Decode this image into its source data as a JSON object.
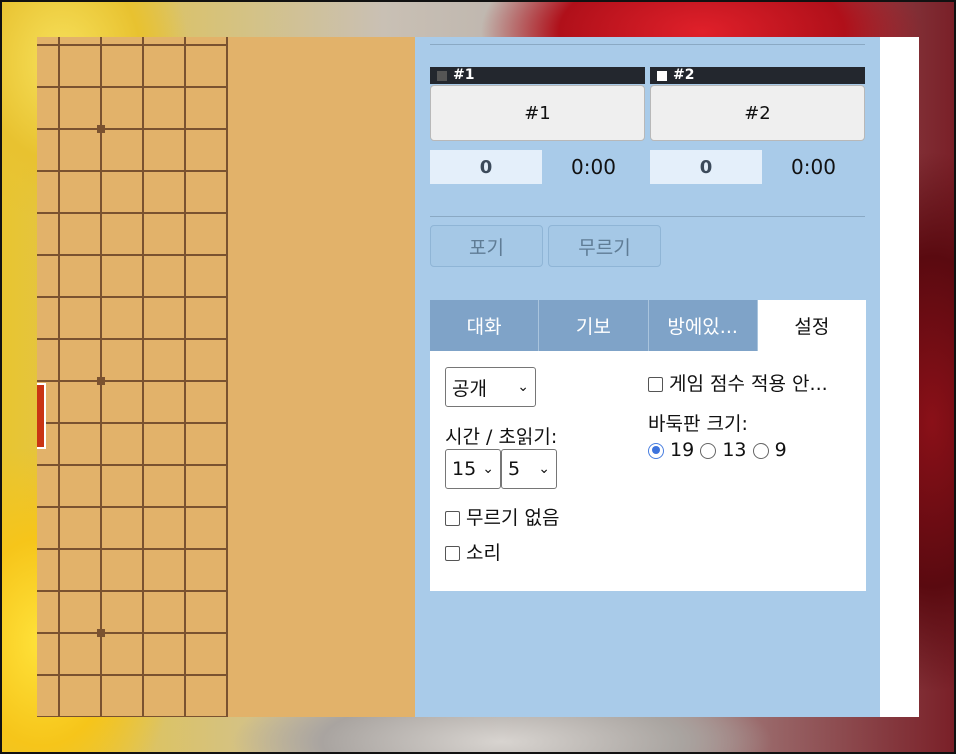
{
  "players": [
    {
      "header": "#1",
      "button": "#1",
      "score": "0",
      "time": "0:00",
      "color": "#555555"
    },
    {
      "header": "#2",
      "button": "#2",
      "score": "0",
      "time": "0:00",
      "color": "#ffffff"
    }
  ],
  "actions": {
    "resign": "포기",
    "undo": "무르기"
  },
  "tabs": [
    "대화",
    "기보",
    "방에있...",
    "설정"
  ],
  "active_tab": "설정",
  "settings": {
    "visibility": "공개",
    "time_label": "시간 / 초읽기:",
    "time_minutes": "15",
    "byoyomi": "5",
    "no_undo": "무르기 없음",
    "sound": "소리",
    "no_rating": "게임 점수 적용 안...",
    "board_size_label": "바둑판 크기:",
    "board_sizes": [
      "19",
      "13",
      "9"
    ],
    "selected_board_size": "19"
  },
  "colors": {
    "board": "#e2b26a",
    "panel": "#a9cbe9",
    "tab": "#7fa3c8",
    "header": "#23272e",
    "marker": "#c93414"
  }
}
